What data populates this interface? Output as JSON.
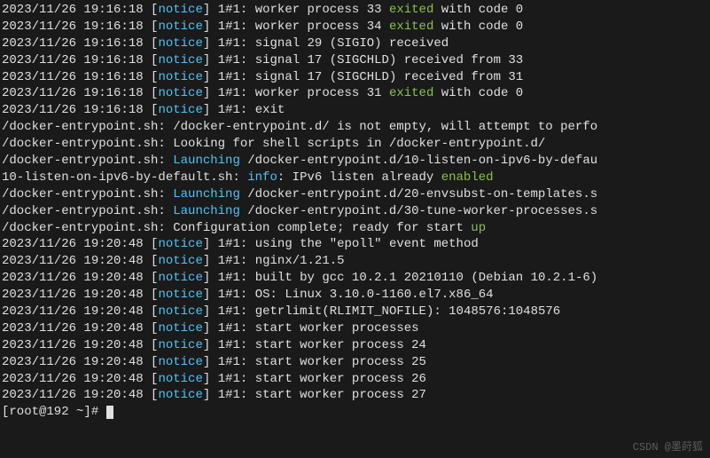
{
  "lines": [
    {
      "ts": "2023/11/26 19:16:18",
      "level": "notice",
      "pid": "1#1",
      "pre": "worker process 33 ",
      "hl": "exited",
      "post": " with code 0",
      "hlClass": "exited"
    },
    {
      "ts": "2023/11/26 19:16:18",
      "level": "notice",
      "pid": "1#1",
      "pre": "worker process 34 ",
      "hl": "exited",
      "post": " with code 0",
      "hlClass": "exited"
    },
    {
      "ts": "2023/11/26 19:16:18",
      "level": "notice",
      "pid": "1#1",
      "pre": "signal 29 (SIGIO) received",
      "hl": "",
      "post": "",
      "hlClass": ""
    },
    {
      "ts": "2023/11/26 19:16:18",
      "level": "notice",
      "pid": "1#1",
      "pre": "signal 17 (SIGCHLD) received from 33",
      "hl": "",
      "post": "",
      "hlClass": ""
    },
    {
      "ts": "2023/11/26 19:16:18",
      "level": "notice",
      "pid": "1#1",
      "pre": "signal 17 (SIGCHLD) received from 31",
      "hl": "",
      "post": "",
      "hlClass": ""
    },
    {
      "ts": "2023/11/26 19:16:18",
      "level": "notice",
      "pid": "1#1",
      "pre": "worker process 31 ",
      "hl": "exited",
      "post": " with code 0",
      "hlClass": "exited"
    },
    {
      "ts": "2023/11/26 19:16:18",
      "level": "notice",
      "pid": "1#1",
      "pre": "exit",
      "hl": "",
      "post": "",
      "hlClass": ""
    }
  ],
  "entrypoint": [
    {
      "prefix": "/docker-entrypoint.sh: ",
      "hl": "",
      "mid": "/docker-entrypoint.d/ is not empty, will attempt to perfo",
      "hlClass": ""
    },
    {
      "prefix": "/docker-entrypoint.sh: ",
      "hl": "",
      "mid": "Looking for shell scripts in /docker-entrypoint.d/",
      "hlClass": ""
    },
    {
      "prefix": "/docker-entrypoint.sh: ",
      "hl": "Launching",
      "mid": " /docker-entrypoint.d/10-listen-on-ipv6-by-defau",
      "hlClass": "launching"
    },
    {
      "prefix": "10-listen-on-ipv6-by-default.sh: ",
      "hl": "info",
      "mid": ": IPv6 listen already ",
      "post": "enabled",
      "hlClass": "info-level",
      "postClass": "enabled"
    },
    {
      "prefix": "/docker-entrypoint.sh: ",
      "hl": "Launching",
      "mid": " /docker-entrypoint.d/20-envsubst-on-templates.s",
      "hlClass": "launching"
    },
    {
      "prefix": "/docker-entrypoint.sh: ",
      "hl": "Launching",
      "mid": " /docker-entrypoint.d/30-tune-worker-processes.s",
      "hlClass": "launching"
    },
    {
      "prefix": "/docker-entrypoint.sh: ",
      "hl": "",
      "mid": "Configuration complete; ready for start ",
      "post": "up",
      "hlClass": "",
      "postClass": "up"
    }
  ],
  "lines2": [
    {
      "ts": "2023/11/26 19:20:48",
      "level": "notice",
      "pid": "1#1",
      "pre": "using the \"epoll\" event method"
    },
    {
      "ts": "2023/11/26 19:20:48",
      "level": "notice",
      "pid": "1#1",
      "pre": "nginx/1.21.5"
    },
    {
      "ts": "2023/11/26 19:20:48",
      "level": "notice",
      "pid": "1#1",
      "pre": "built by gcc 10.2.1 20210110 (Debian 10.2.1-6)"
    },
    {
      "ts": "2023/11/26 19:20:48",
      "level": "notice",
      "pid": "1#1",
      "pre": "OS: Linux 3.10.0-1160.el7.x86_64"
    },
    {
      "ts": "2023/11/26 19:20:48",
      "level": "notice",
      "pid": "1#1",
      "pre": "getrlimit(RLIMIT_NOFILE): 1048576:1048576"
    },
    {
      "ts": "2023/11/26 19:20:48",
      "level": "notice",
      "pid": "1#1",
      "pre": "start worker processes"
    },
    {
      "ts": "2023/11/26 19:20:48",
      "level": "notice",
      "pid": "1#1",
      "pre": "start worker process 24"
    },
    {
      "ts": "2023/11/26 19:20:48",
      "level": "notice",
      "pid": "1#1",
      "pre": "start worker process 25"
    },
    {
      "ts": "2023/11/26 19:20:48",
      "level": "notice",
      "pid": "1#1",
      "pre": "start worker process 26"
    },
    {
      "ts": "2023/11/26 19:20:48",
      "level": "notice",
      "pid": "1#1",
      "pre": "start worker process 27"
    }
  ],
  "prompt": "[root@192 ~]# ",
  "watermark": "CSDN @墨莳狐"
}
